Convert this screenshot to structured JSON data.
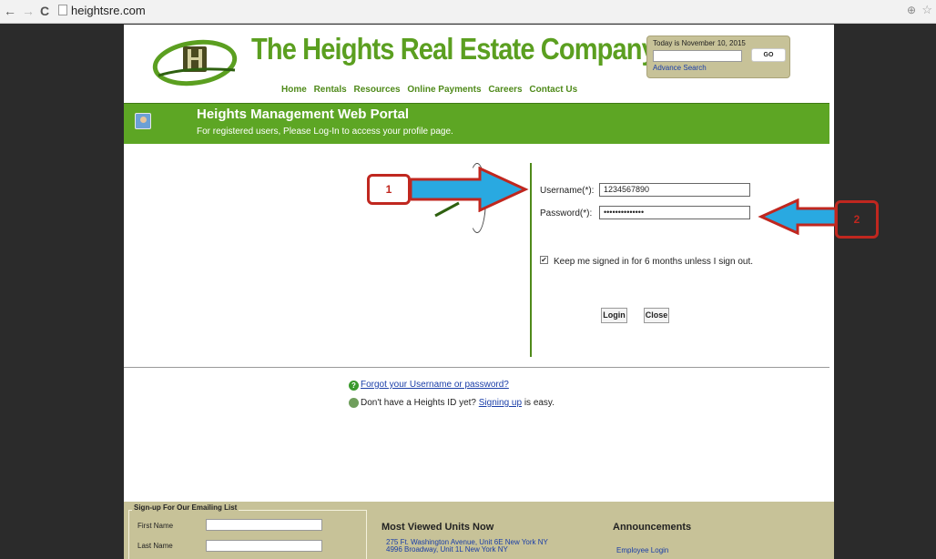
{
  "browser": {
    "url": "heightsre.com",
    "back_glyph": "←",
    "forward_glyph": "→",
    "reload_glyph": "C",
    "zoom_glyph": "⊕",
    "star_glyph": "☆"
  },
  "header": {
    "site_title": "The Heights Real Estate Company",
    "nav": [
      "Home",
      "Rentals",
      "Resources",
      "Online Payments",
      "Careers",
      "Contact Us"
    ],
    "date_text": "Today is November 10, 2015",
    "go_label": "GO",
    "advance_search": "Advance Search"
  },
  "banner": {
    "title": "Heights Management Web Portal",
    "subtitle": "For registered users, Please Log-In to access your profile page."
  },
  "login": {
    "username_label": "Username(*):",
    "username_value": "1234567890",
    "password_label": "Password(*):",
    "password_value": "••••••••••••••",
    "keep_signed_in": "Keep me signed in for 6 months unless I sign out.",
    "login_button": "Login",
    "close_button": "Close"
  },
  "help": {
    "forgot": "Forgot your Username or password?",
    "no_id": "Don't have a Heights ID yet?",
    "signing_up": "Signing up",
    "is_easy": "is easy."
  },
  "footer": {
    "mailing_title": "Sign-up For Our Emailing List",
    "first_name": "First Name",
    "last_name": "Last Name",
    "most_viewed_title": "Most Viewed Units Now",
    "units": [
      "275 Ft. Washington Avenue, Unit 6E New York NY",
      "4996 Broadway, Unit 1L New York NY"
    ],
    "announcements_title": "Announcements",
    "employee_login": "Employee Login"
  },
  "annotations": {
    "label_1": "1",
    "label_2": "2"
  },
  "colors": {
    "brand_green": "#5da624",
    "annotation_red": "#c0271f",
    "annotation_arrow_blue": "#29a9e1",
    "footer_tan": "#c7c298"
  }
}
